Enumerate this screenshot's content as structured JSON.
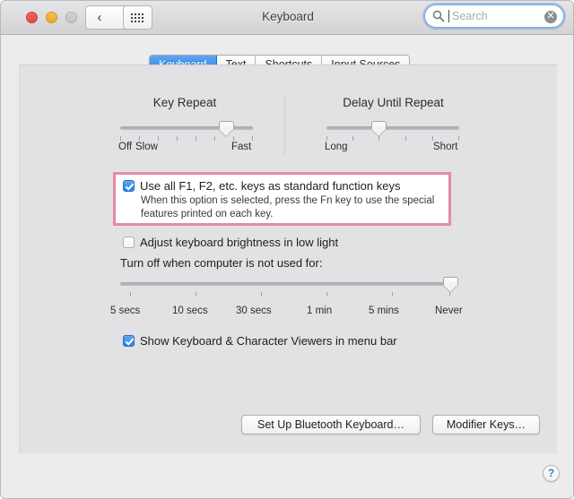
{
  "window": {
    "title": "Keyboard",
    "traffic_lights": [
      "close",
      "minimize",
      "zoom"
    ],
    "nav_back": "‹",
    "nav_forward": "›",
    "grid_icon": "show-all-icon"
  },
  "search": {
    "placeholder": "Search",
    "value": "",
    "clear_label": "✕",
    "icon": "search-icon"
  },
  "tabs": [
    {
      "label": "Keyboard",
      "selected": true
    },
    {
      "label": "Text",
      "selected": false
    },
    {
      "label": "Shortcuts",
      "selected": false
    },
    {
      "label": "Input Sources",
      "selected": false
    }
  ],
  "key_repeat": {
    "title": "Key Repeat",
    "label_left": "Off",
    "label_left2": "Slow",
    "label_right": "Fast",
    "ticks": 8,
    "value_index": 7
  },
  "delay_until_repeat": {
    "title": "Delay Until Repeat",
    "label_left": "Long",
    "label_right": "Short",
    "ticks": 6,
    "value_index": 2
  },
  "function_keys": {
    "label": "Use all F1, F2, etc. keys as standard function keys",
    "description_line1": "When this option is selected, press the Fn key to use the special",
    "description_line2": "features printed on each key.",
    "checked": true,
    "highlight_color": "#e58aa6"
  },
  "brightness": {
    "label": "Adjust keyboard brightness in low light",
    "checked": false
  },
  "turn_off": {
    "label": "Turn off when computer is not used for:",
    "tick_labels": [
      "5 secs",
      "10 secs",
      "30 secs",
      "1 min",
      "5 mins",
      "Never"
    ],
    "value": "Never",
    "value_index": 5
  },
  "viewers": {
    "label": "Show Keyboard & Character Viewers in menu bar",
    "checked": true
  },
  "buttons": {
    "bluetooth": "Set Up Bluetooth Keyboard…",
    "modifier": "Modifier Keys…",
    "help": "?"
  }
}
